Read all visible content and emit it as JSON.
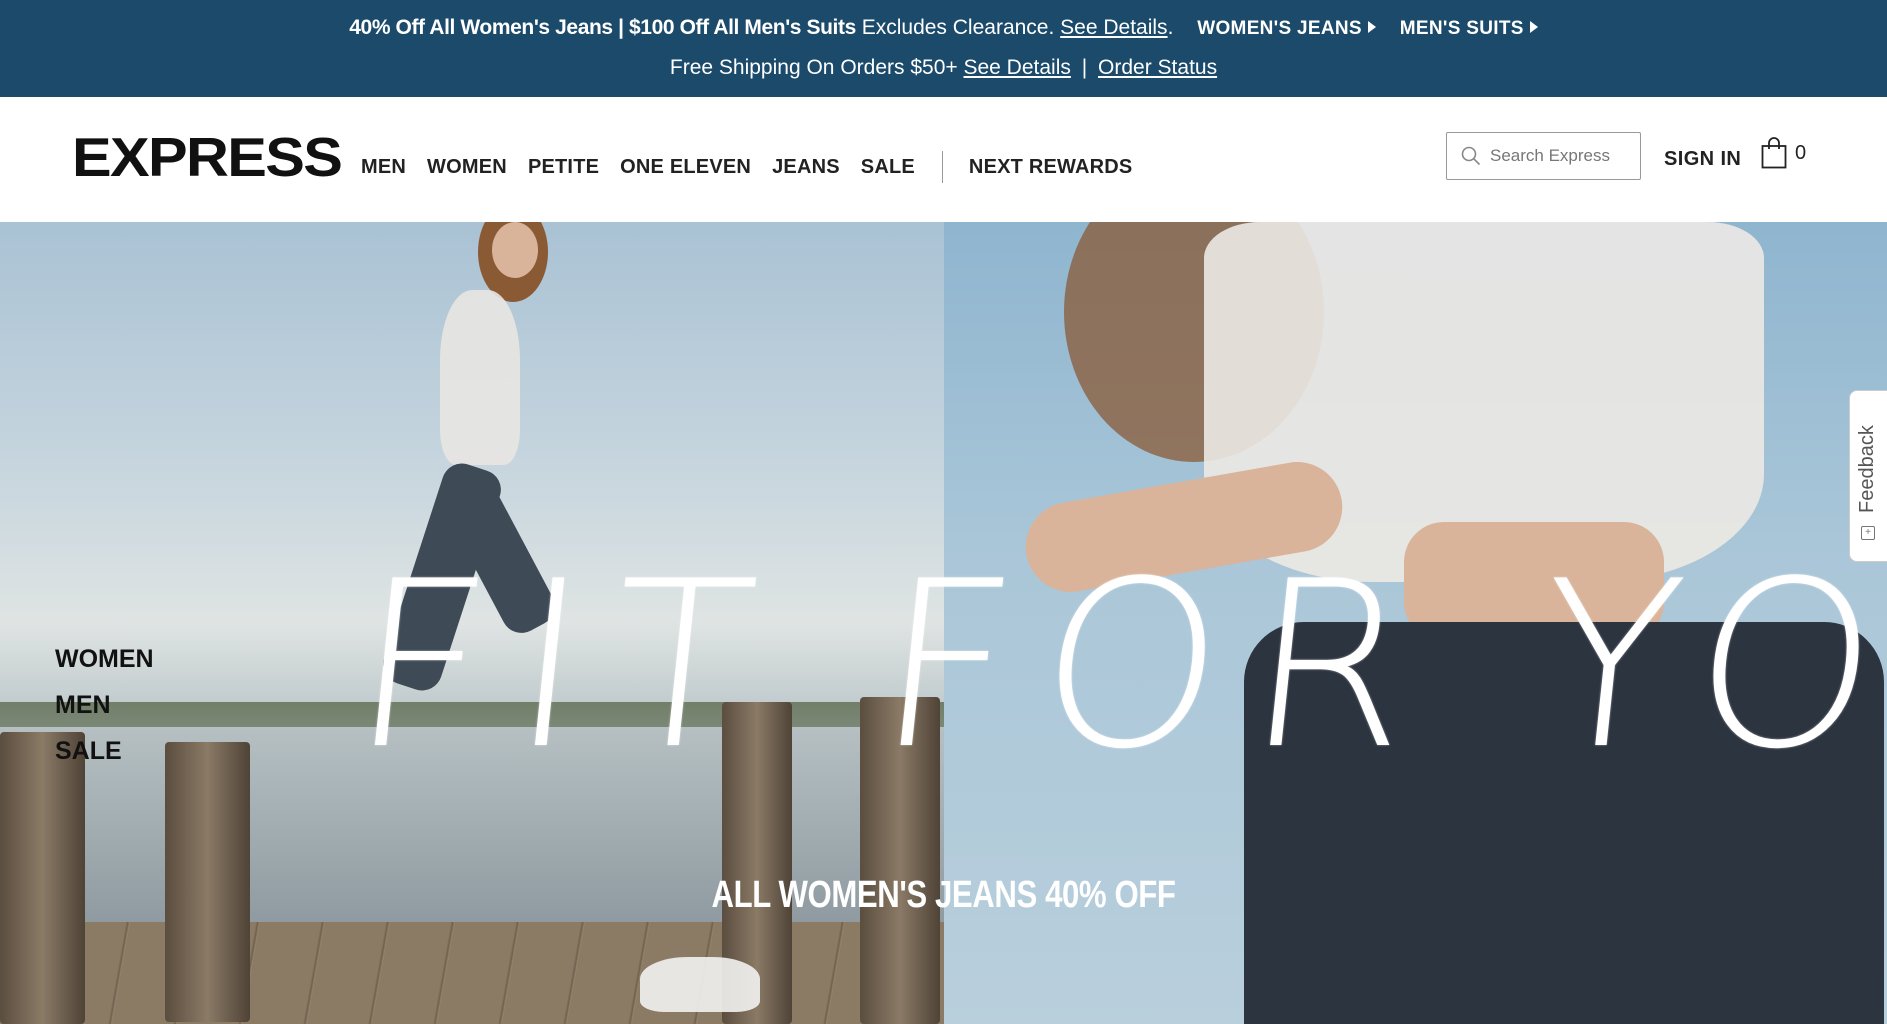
{
  "promo": {
    "headline": "40% Off All Women's Jeans | $100 Off All Men's Suits",
    "excludes": "Excludes Clearance.",
    "see_details_1": "See Details",
    "period": ".",
    "cta_womens": "WOMEN'S JEANS",
    "cta_mens": "MEN'S SUITS",
    "shipping": "Free Shipping On Orders $50+",
    "see_details_2": "See Details",
    "separator": "|",
    "order_status": "Order Status"
  },
  "header": {
    "logo": "EXPRESS",
    "nav": [
      "MEN",
      "WOMEN",
      "PETITE",
      "ONE ELEVEN",
      "JEANS",
      "SALE"
    ],
    "rewards": "NEXT REWARDS",
    "search_placeholder": "Search Express",
    "sign_in": "SIGN IN",
    "bag_count": "0"
  },
  "hero": {
    "title": "FIT FOR YOU",
    "subtitle": "ALL WOMEN'S JEANS 40% OFF",
    "side_links": [
      "WOMEN",
      "MEN",
      "SALE"
    ]
  },
  "feedback": {
    "label": "Feedback"
  },
  "colors": {
    "promo_bg": "#1b4a6b",
    "text_dark": "#222222"
  },
  "icons": [
    "search-icon",
    "shopping-bag-icon",
    "caret-right-icon",
    "feedback-icon"
  ]
}
